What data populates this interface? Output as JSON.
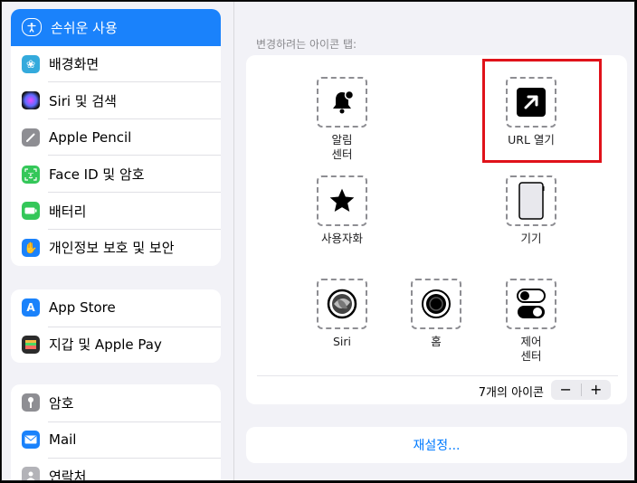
{
  "sidebar": {
    "group1": [
      {
        "label": "손쉬운 사용",
        "icon": "accessibility-icon",
        "color": "#1a82fb",
        "active": true
      },
      {
        "label": "배경화면",
        "icon": "wallpaper-flower-icon",
        "color": "#34aadc"
      },
      {
        "label": "Siri 및 검색",
        "icon": "siri-icon",
        "color": "#2b2b2b"
      },
      {
        "label": "Apple Pencil",
        "icon": "pencil-icon",
        "color": "#8e8e93"
      },
      {
        "label": "Face ID 및 암호",
        "icon": "face-id-icon",
        "color": "#34c759"
      },
      {
        "label": "배터리",
        "icon": "battery-icon",
        "color": "#34c759"
      },
      {
        "label": "개인정보 보호 및 보안",
        "icon": "hand-icon",
        "color": "#1a82fb"
      }
    ],
    "group2": [
      {
        "label": "App Store",
        "icon": "app-store-icon",
        "color": "#1a82fb"
      },
      {
        "label": "지갑 및 Apple Pay",
        "icon": "wallet-icon",
        "color": "#2b2b2b"
      }
    ],
    "group3": [
      {
        "label": "암호",
        "icon": "key-icon",
        "color": "#8e8e93"
      },
      {
        "label": "Mail",
        "icon": "mail-icon",
        "color": "#1a82fb"
      },
      {
        "label": "연락처",
        "icon": "contacts-icon",
        "color": "#b3b3b8"
      }
    ]
  },
  "main": {
    "section_caption": "변경하려는 아이콘 탭:",
    "icons": [
      {
        "label": "알림\n센터",
        "icon": "notification-bell-icon"
      },
      {
        "label": "URL 열기",
        "icon": "open-url-arrow-icon"
      },
      {
        "label": "사용자화",
        "icon": "star-icon"
      },
      {
        "label": "기기",
        "icon": "device-ipad-icon"
      },
      {
        "label": "Siri",
        "icon": "siri-icon"
      },
      {
        "label": "홈",
        "icon": "home-button-icon"
      },
      {
        "label": "제어\n센터",
        "icon": "control-center-toggle-icon"
      }
    ],
    "count_label": "7개의 아이콘",
    "stepper": {
      "minus": "−",
      "plus": "+"
    },
    "reset_label": "재설정..."
  },
  "colors": {
    "accent": "#1a82fb",
    "link": "#007aff",
    "highlight": "#e0121a"
  }
}
